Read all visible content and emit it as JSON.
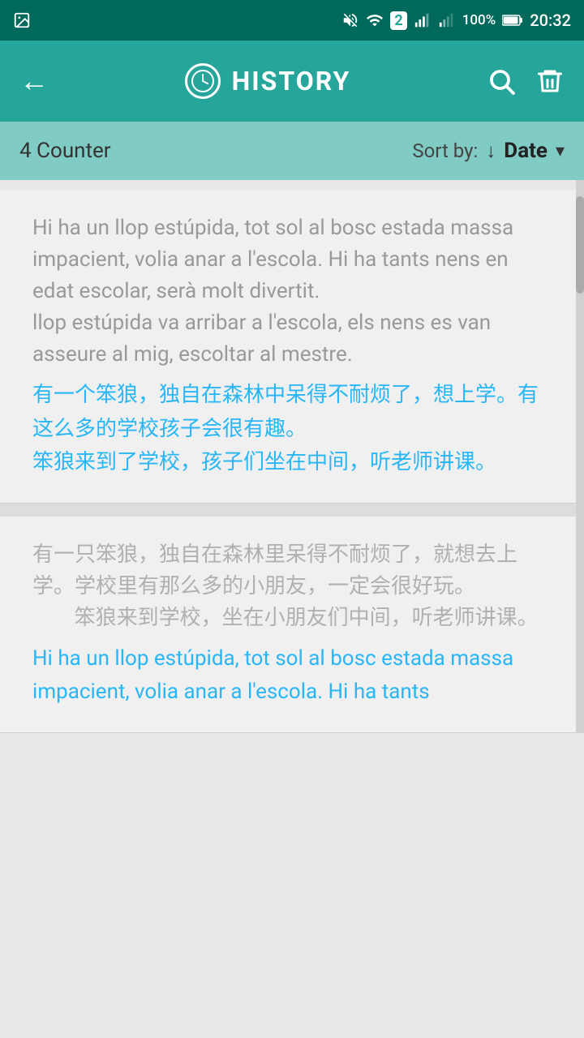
{
  "statusBar": {
    "time": "20:32",
    "battery": "100%",
    "icons": [
      "mute",
      "wifi",
      "sim2",
      "signal",
      "battery"
    ]
  },
  "appBar": {
    "title": "HISTORY",
    "backLabel": "←",
    "searchLabel": "search",
    "deleteLabel": "delete"
  },
  "sortBar": {
    "counter": "4 Counter",
    "sortByLabel": "Sort by:",
    "sortValue": "Date"
  },
  "historyItems": [
    {
      "id": 1,
      "greyText": "Hi ha un llop estúpida, tot sol al bosc estada massa impacient, volia anar a l'escola. Hi ha tants nens en edat escolar, serà molt divertit.\nllop estúpida va arribar a l'escola, els nens es van asseure al mig, escoltar al mestre.",
      "blueText": "有一个笨狼，独自在森林中呆得不耐烦了，想上学。有这么多的学校孩子会很有趣。\n笨狼来到了学校，孩子们坐在中间，听老师讲课。"
    },
    {
      "id": 2,
      "greyText": "有一只笨狼，独自在森林里呆得不耐烦了，就想去上学。学校里有那么多的小朋友，一定会很好玩。\n        笨狼来到学校，坐在小朋友们中间，听老师讲课。",
      "blueText": "Hi ha un llop estúpida, tot sol al bosc estada massa impacient, volia anar a l'escola. Hi ha tants"
    }
  ]
}
